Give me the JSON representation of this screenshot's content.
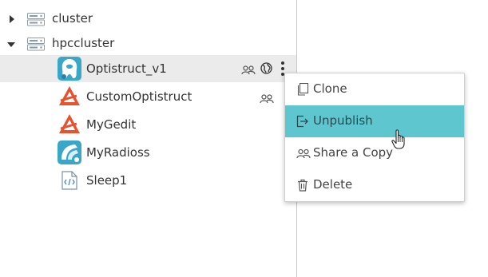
{
  "tree": {
    "nodes": [
      {
        "label": "cluster",
        "expanded": false,
        "icon": "server-icon"
      },
      {
        "label": "hpccluster",
        "expanded": true,
        "icon": "server-icon"
      }
    ],
    "apps": [
      {
        "label": "Optistruct_v1",
        "icon": "optistruct-app-icon",
        "selected": true
      },
      {
        "label": "CustomOptistruct",
        "icon": "altair-logo-icon"
      },
      {
        "label": "MyGedit",
        "icon": "altair-logo-icon"
      },
      {
        "label": "MyRadioss",
        "icon": "radioss-app-icon"
      },
      {
        "label": "Sleep1",
        "icon": "code-file-icon"
      }
    ]
  },
  "context_menu": {
    "items": [
      {
        "label": "Clone",
        "icon": "clone-icon"
      },
      {
        "label": "Unpublish",
        "icon": "unpublish-icon",
        "hovered": true
      },
      {
        "label": "Share a Copy",
        "icon": "share-users-icon"
      },
      {
        "label": "Delete",
        "icon": "trash-icon"
      }
    ]
  },
  "colors": {
    "menu_hover": "#5dc6cf",
    "selected_row": "#ebebeb",
    "altair_orange": "#e8532e",
    "app_teal": "#3aa7c9"
  }
}
